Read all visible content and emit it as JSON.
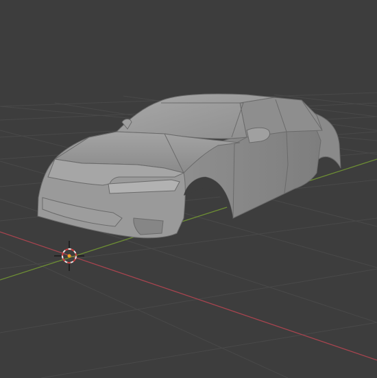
{
  "viewport": {
    "background": "#3d3d3d",
    "grid_color": "#4a4a4a",
    "x_axis_color": "#b34a58",
    "y_axis_color": "#7a9a3a"
  },
  "scene": {
    "object": "car-body-mesh",
    "mesh_color": "#9c9c9c",
    "cursor_icon": "3d-cursor-icon"
  }
}
